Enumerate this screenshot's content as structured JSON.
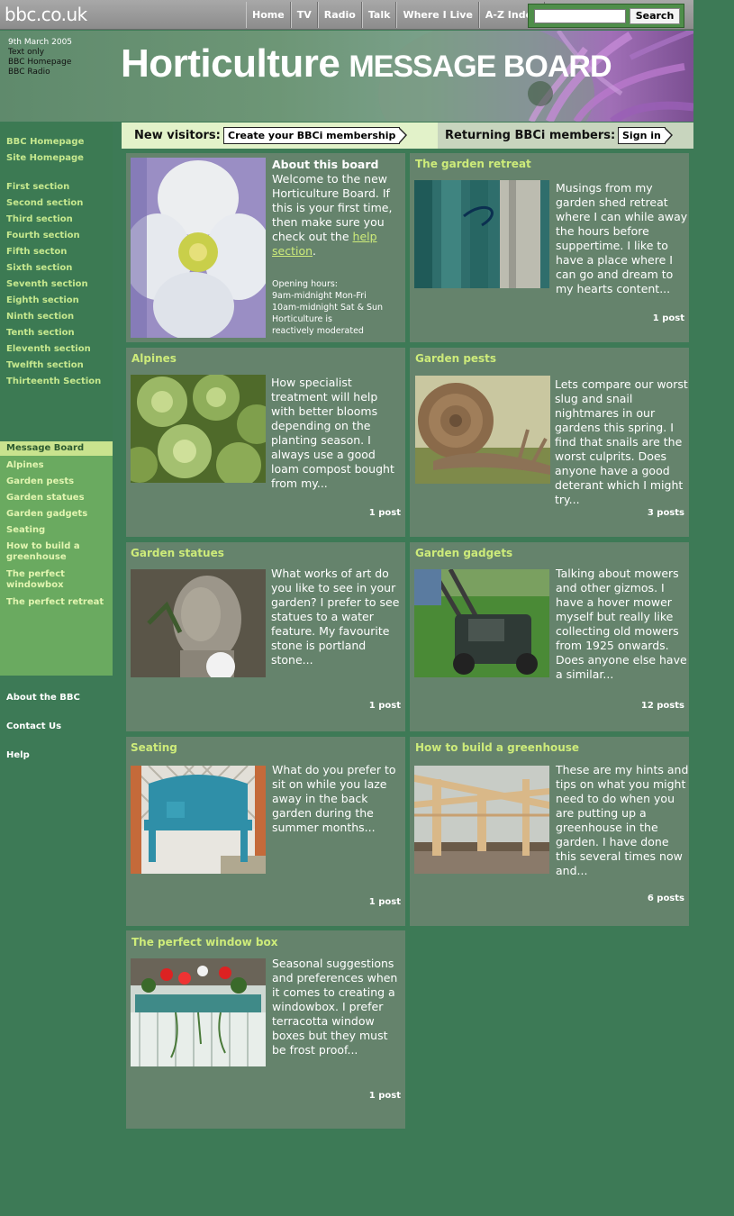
{
  "site": {
    "logo": "bbc.co.uk"
  },
  "topnav": [
    "Home",
    "TV",
    "Radio",
    "Talk",
    "Where I Live",
    "A-Z Index"
  ],
  "search": {
    "button": "Search",
    "value": ""
  },
  "banner": {
    "date": "9th March 2005",
    "links": [
      "Text only",
      "BBC Homepage",
      "BBC Radio"
    ],
    "title": "Horticulture",
    "subtitle": "MESSAGE BOARD"
  },
  "leftnav": {
    "top_links": [
      "BBC Homepage",
      "Site Homepage"
    ],
    "sections": [
      "First section",
      "Second section",
      "Third section",
      "Fourth section",
      "Fifth secton",
      "Sixth section",
      "Seventh section",
      "Eighth section",
      "Ninth section",
      "Tenth section",
      "Eleventh section",
      "Twelfth section",
      "Thirteenth Section"
    ],
    "board_heading": "Message Board",
    "boards": [
      "Alpines",
      "Garden pests",
      "Garden statues",
      "Garden gadgets",
      "Seating",
      "How to build a greenhouse",
      "The perfect windowbox",
      "The perfect retreat"
    ],
    "footer": [
      "About the BBC",
      "Contact Us",
      "Help"
    ]
  },
  "membership": {
    "new_label": "New visitors:",
    "new_button": "Create your BBCi membership",
    "return_label": "Returning BBCi members:",
    "return_button": "Sign in"
  },
  "about": {
    "title": "About this board",
    "text": "Welcome to the new Horticulture Board. If this is your first time, then make sure you check out the",
    "help_link": "help section",
    "help_suffix": ".",
    "hours": [
      "Opening hours:",
      "9am-midnight Mon-Fri",
      "10am-midnight Sat & Sun",
      "Horticulture is",
      "reactively moderated"
    ]
  },
  "boards": [
    {
      "title": "The garden retreat",
      "text": "Musings from my garden shed retreat where I can while away the hours before suppertime. I like to have a place where I can go and dream to my hearts content...",
      "count": "1 post"
    },
    {
      "title": "Alpines",
      "text": "How specialist treatment will help with better blooms depending on the planting season. I always use a good loam compost bought from my...",
      "count": "1 post"
    },
    {
      "title": "Garden pests",
      "text": "Lets compare our worst slug and snail nightmares in our gardens this spring. I find that snails are the worst culprits. Does anyone have a good deterant which I might try...",
      "count": "3 posts"
    },
    {
      "title": "Garden statues",
      "text": "What works of art do you like to see in your garden? I prefer to see statues to a water feature. My favourite stone is portland stone...",
      "count": "1 post"
    },
    {
      "title": "Garden gadgets",
      "text": "Talking about mowers and other gizmos. I have a hover mower myself but really like collecting old mowers from 1925 onwards. Does anyone else have a similar...",
      "count": "12 posts"
    },
    {
      "title": "Seating",
      "text": "What do you prefer to sit on while you laze away in the back garden during the summer months...",
      "count": "1 post"
    },
    {
      "title": "How to build a greenhouse",
      "text": "These are my hints and tips on what you might need to do when you are putting up a greenhouse in the garden. I have done this several times now and...",
      "count": "6 posts"
    },
    {
      "title": "The perfect window box",
      "text": "Seasonal suggestions and preferences when it comes to creating a windowbox. I prefer terracotta window boxes but they must be frost proof...",
      "count": "1 post"
    }
  ]
}
